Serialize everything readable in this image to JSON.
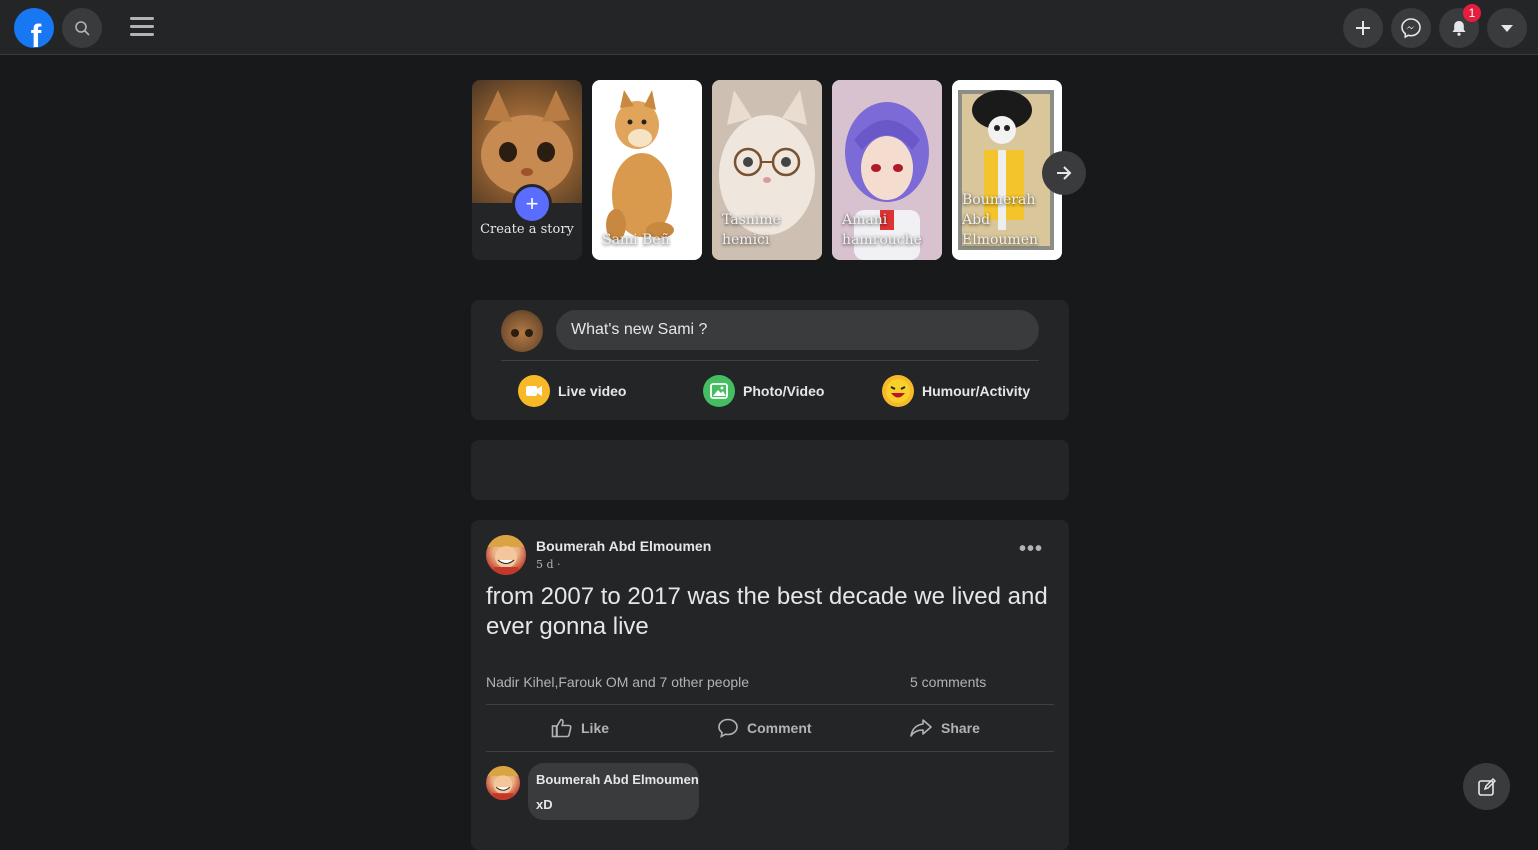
{
  "topbar": {
    "logo_letter": "f",
    "notifications_count": "1"
  },
  "stories": {
    "create_label": "Create a story",
    "items": [
      {
        "name": "Sami Beñ"
      },
      {
        "name": "Tasnime hemici"
      },
      {
        "name": "Amani hamrouche"
      },
      {
        "name": "Boumerah Abd Elmoumen"
      }
    ]
  },
  "composer": {
    "placeholder": "What's new Sami ?",
    "actions": [
      {
        "label": "Live video",
        "color": "#f7b928"
      },
      {
        "label": "Photo/Video",
        "color": "#45bd62"
      },
      {
        "label": "Humour/Activity",
        "color": "#f7b928"
      }
    ]
  },
  "post": {
    "author": "Boumerah Abd Elmoumen",
    "time": "5 d ·",
    "text": "from 2007 to 2017 was the best decade we lived and ever gonna live",
    "reactions": "Nadir Kihel,Farouk OM and 7 other people",
    "comments_count": "5 comments",
    "actions": {
      "like": "Like",
      "comment": "Comment",
      "share": "Share"
    },
    "comment": {
      "author": "Boumerah Abd Elmoumen",
      "text": "xD"
    }
  },
  "icons": [
    "search-icon",
    "menu-icon",
    "plus-icon",
    "messenger-icon",
    "bell-icon",
    "caret-down-icon",
    "arrow-right-icon",
    "like-icon",
    "comment-icon",
    "share-icon",
    "compose-icon"
  ],
  "colors": {
    "brand": "#1877f2",
    "badge": "#e41e3f",
    "create_plus": "#5b6dff"
  }
}
